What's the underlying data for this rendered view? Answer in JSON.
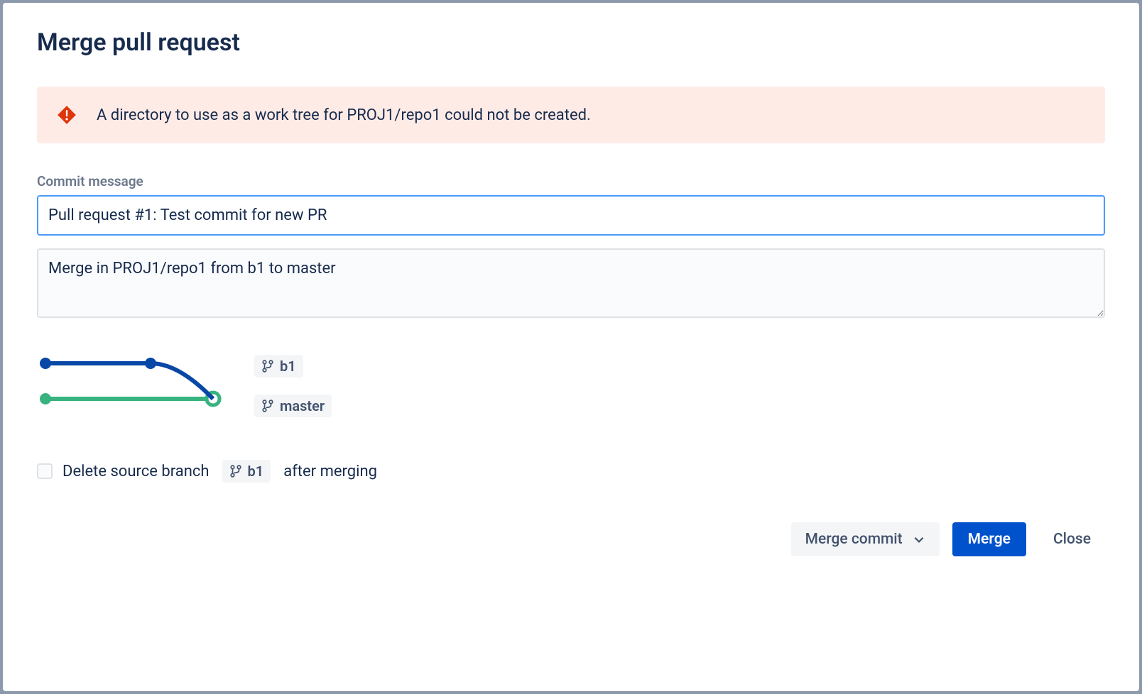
{
  "modal": {
    "title": "Merge pull request"
  },
  "error": {
    "message": "A directory to use as a work tree for PROJ1/repo1 could not be created."
  },
  "commit": {
    "field_label": "Commit message",
    "subject": "Pull request #1: Test commit for new PR",
    "body": "Merge in PROJ1/repo1 from b1 to master"
  },
  "branches": {
    "source": "b1",
    "target": "master"
  },
  "delete_branch": {
    "prefix": "Delete source branch",
    "branch": "b1",
    "suffix": "after merging",
    "checked": false
  },
  "footer": {
    "strategy_label": "Merge commit",
    "merge_label": "Merge",
    "close_label": "Close"
  },
  "colors": {
    "primary": "#0052CC",
    "source_branch": "#0747A6",
    "target_branch": "#36B37E",
    "error_bg": "#FFEBE6",
    "error_icon": "#DE350B"
  }
}
